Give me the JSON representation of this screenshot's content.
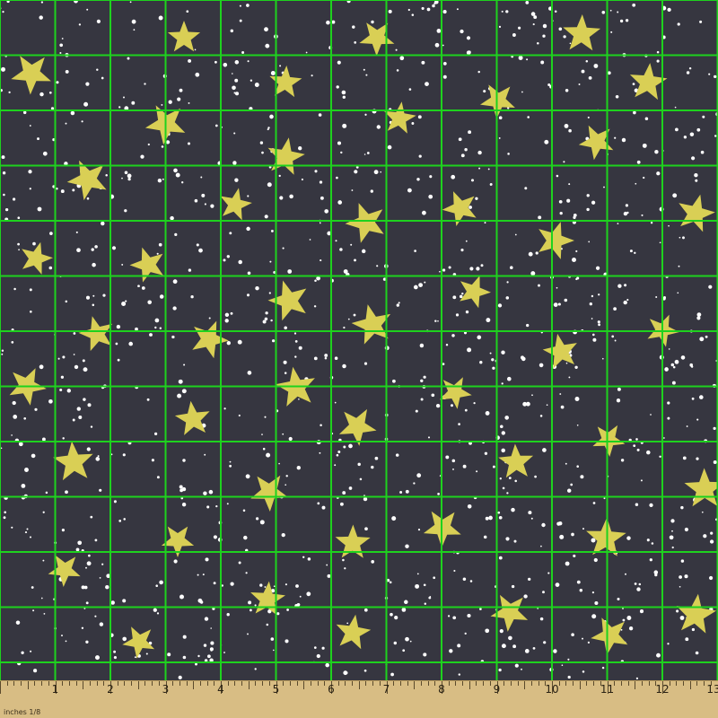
{
  "image": {
    "subject": "star-print-fabric-swatch",
    "colors": {
      "background": "#363640",
      "star": "#d9cf55",
      "dot": "#ffffff",
      "grid": "#1ed21e",
      "ruler": "#d8bd84"
    }
  },
  "ruler": {
    "label": "inches 1/8",
    "numbers": [
      "1",
      "2",
      "3",
      "4",
      "5",
      "6",
      "7",
      "8",
      "9",
      "10",
      "11",
      "12",
      "13"
    ]
  }
}
